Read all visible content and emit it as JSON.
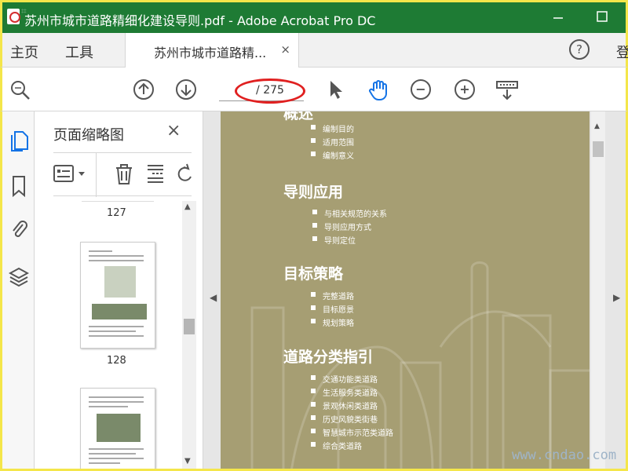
{
  "window": {
    "title": "苏州市城市道路精细化建设导则.pdf - Adobe Acrobat Pro DC",
    "minimize_icon": "minimize-icon",
    "maximize_icon": "maximize-icon"
  },
  "tabs": {
    "home": "主页",
    "tools": "工具",
    "document": "苏州市城市道路精...",
    "close": "×",
    "login": "登"
  },
  "toolbar": {
    "page_total": "/ 275",
    "icons": [
      "search-icon",
      "page-up-icon",
      "page-down-icon",
      "select-arrow-icon",
      "hand-tool-icon",
      "zoom-out-icon",
      "zoom-in-icon",
      "scroll-mode-icon"
    ]
  },
  "left_rail": {
    "icons": [
      "page-thumbnails-icon",
      "bookmark-icon",
      "attachment-icon",
      "layers-icon"
    ]
  },
  "panel": {
    "title": "页面缩略图",
    "close": "×",
    "pages": [
      "127",
      "128"
    ]
  },
  "document": {
    "sections": [
      {
        "heading": "概述",
        "items": [
          "编制目的",
          "适用范围",
          "编制意义"
        ]
      },
      {
        "heading": "导则应用",
        "items": [
          "与相关规范的关系",
          "导则应用方式",
          "导则定位"
        ]
      },
      {
        "heading": "目标策略",
        "items": [
          "完整道路",
          "目标愿景",
          "规划策略"
        ]
      },
      {
        "heading": "道路分类指引",
        "items": [
          "交通功能类道路",
          "生活服务类道路",
          "景观休闲类道路",
          "历史风貌类街巷",
          "智慧城市示范类道路",
          "综合类道路"
        ]
      }
    ]
  },
  "watermark": "www.cndao.com",
  "colors": {
    "titlebar": "#1e7b34",
    "page_bg": "#a69e73",
    "accent_blue": "#1473e6",
    "highlight_red": "#e02020"
  }
}
